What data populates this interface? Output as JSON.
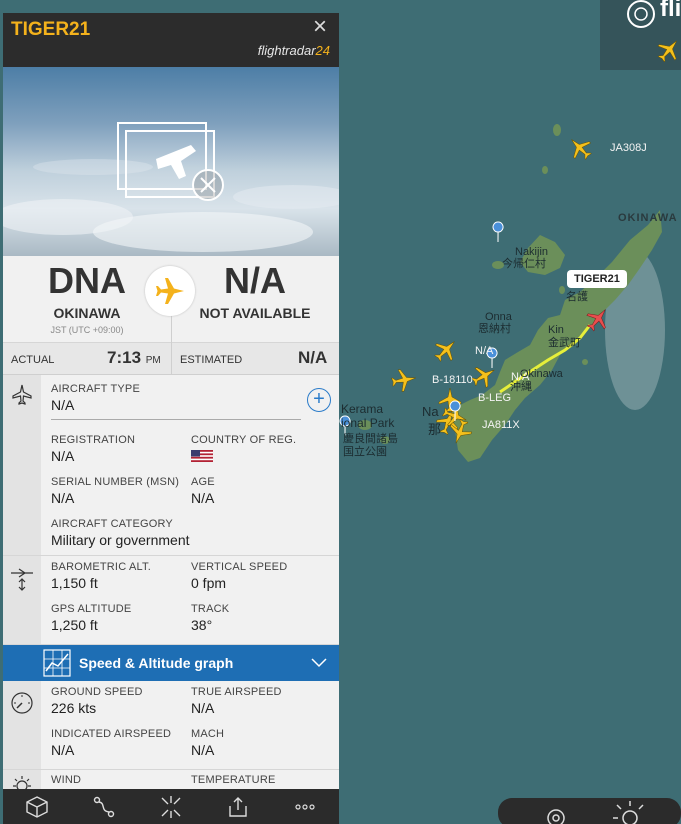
{
  "map": {
    "brand_fragment": "fli",
    "labels": {
      "ja308j": "JA308J",
      "okinawa_region": "OKINAWA",
      "nakijin": "Nakijin",
      "nakijin_jp": "今帰仁村",
      "nago_jp": "名護",
      "onna": "Onna",
      "onna_jp": "恩納村",
      "kin": "Kin",
      "kin_jp": "金武町",
      "na1": "N/A",
      "na2": "N/A",
      "okinawa_city": "Okinawa",
      "okinawa_city_jp": "沖縄",
      "b18110": "B-18110",
      "bleg": "B-LEG",
      "kerama": "Kerama",
      "national_park": "ional Park",
      "kerama_jp": "慶良間諸島",
      "kokuritsu": "国立公園",
      "naha": "Na",
      "naha_jp": "那",
      "ja811x": "JA811X",
      "tiger_tag": "TIGER21"
    }
  },
  "panel": {
    "callsign": "TIGER21",
    "brand_main": "flightradar",
    "brand_num": "24",
    "origin_code": "DNA",
    "origin_name": "OKINAWA",
    "origin_tz": "JST (UTC +09:00)",
    "dest_code": "N/A",
    "dest_name": "NOT AVAILABLE",
    "actual_label": "ACTUAL",
    "actual_time": "7:13",
    "actual_suffix": "PM",
    "estimated_label": "ESTIMATED",
    "estimated_value": "N/A",
    "aircraft_type_label": "AIRCRAFT TYPE",
    "aircraft_type_value": "N/A",
    "registration_label": "REGISTRATION",
    "registration_value": "N/A",
    "country_label": "COUNTRY OF REG.",
    "serial_label": "SERIAL NUMBER (MSN)",
    "serial_value": "N/A",
    "age_label": "AGE",
    "age_value": "N/A",
    "category_label": "AIRCRAFT CATEGORY",
    "category_value": "Military or government",
    "baro_label": "BAROMETRIC ALT.",
    "baro_value": "1,150 ft",
    "vs_label": "VERTICAL SPEED",
    "vs_value": "0 fpm",
    "gps_label": "GPS ALTITUDE",
    "gps_value": "1,250 ft",
    "track_label": "TRACK",
    "track_value": "38°",
    "graph_label": "Speed & Altitude graph",
    "gs_label": "GROUND SPEED",
    "gs_value": "226 kts",
    "tas_label": "TRUE AIRSPEED",
    "tas_value": "N/A",
    "ias_label": "INDICATED AIRSPEED",
    "ias_value": "N/A",
    "mach_label": "MACH",
    "mach_value": "N/A",
    "wind_label": "WIND",
    "temp_label": "TEMPERATURE"
  },
  "colors": {
    "accent": "#f4b21c",
    "graph_bar": "#1e6eb4",
    "selected_aircraft": "#e84e4e",
    "track": "#e6ef3a"
  }
}
